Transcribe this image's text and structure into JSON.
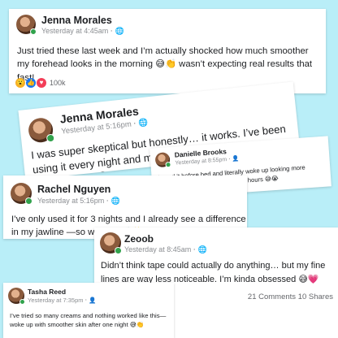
{
  "posts": [
    {
      "author": "Jenna Morales",
      "time": "Yesterday at 4:45am",
      "text": "Just tried these last week and I’m actually shocked how much smoother my forehead looks in the morning",
      "text_emoji": "😅👏",
      "text_after": "wasn’t expecting real results that fast!",
      "reactions": "😮👍❤️",
      "reaction_count": "100k"
    },
    {
      "author": "Jenna Morales",
      "time": "Yesterday at 5:16pm",
      "text": "I was super skeptical but honestly… it works. I’ve been using it every night and my skin looks way more lifted in the mornings",
      "text_emoji": "😍"
    },
    {
      "author": "Danielle Brooks",
      "time": "Yesterday at 8:55pm",
      "text": "I used it before bed and literally woke up looking more refreshed—like I actually slept 8 hours",
      "text_emoji": "😅😭"
    },
    {
      "author": "Rachel Nguyen",
      "time": "Yesterday at 5:16pm",
      "text": "I’ve only used it for 3 nights and I already see a difference in my jawline —so worth it",
      "text_emoji": "👏✨"
    },
    {
      "author": "Zeoob",
      "time": "Yesterday at 8:45am",
      "text": "Didn’t think tape could actually do anything… but my fine lines are way less noticeable. I’m kinda obsessed",
      "text_emoji": "😅💗",
      "comments": "21 Comments",
      "shares": "10 Shares"
    },
    {
      "author": "Tasha Reed",
      "time": "Yesterday at 7:35pm",
      "text": "I’ve tried so many creams and nothing worked like this—woke up with smoother skin after one night",
      "text_emoji": "😅👏"
    }
  ],
  "icons": {
    "globe": "globe-icon",
    "friends": "friends-icon",
    "online": "online-status-dot"
  },
  "colors": {
    "background": "#b9eef8",
    "online": "#31a24c",
    "like": "#1877f2",
    "love": "#f33e58"
  }
}
